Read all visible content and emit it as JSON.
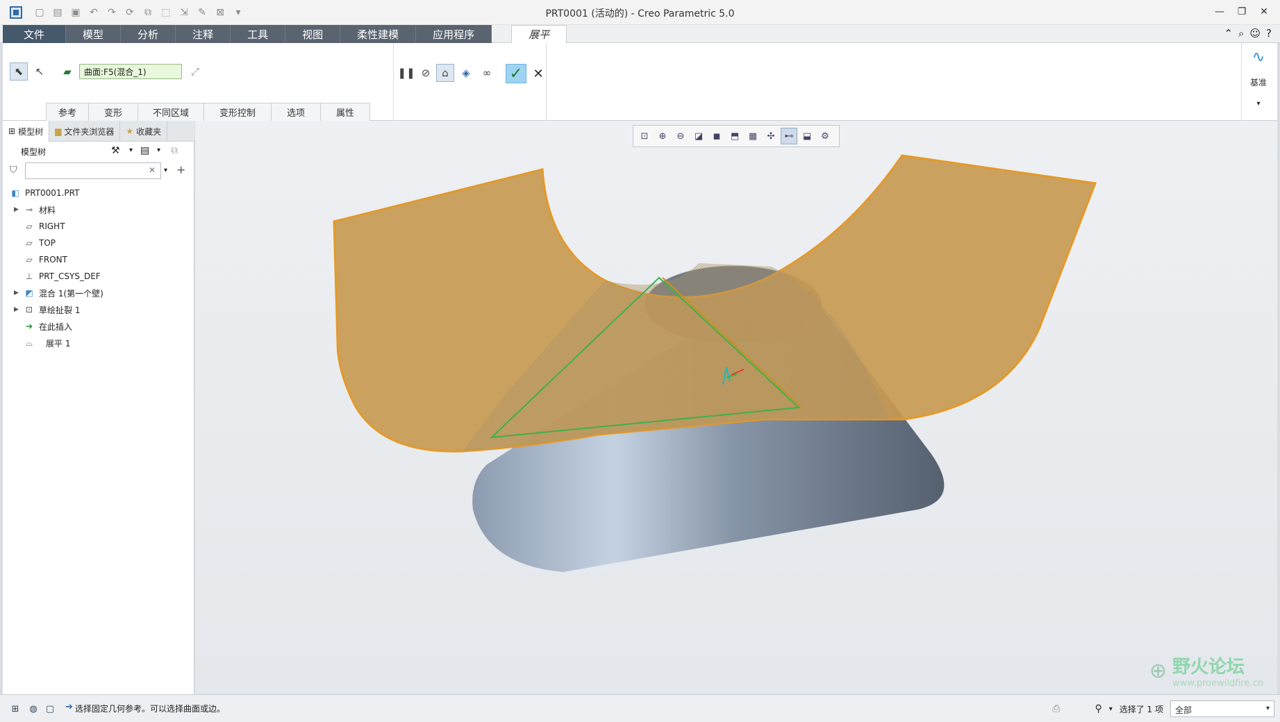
{
  "window": {
    "title": "PRT0001 (活动的) - Creo Parametric 5.0",
    "minimize_icon": "—",
    "restore_icon": "❐",
    "close_icon": "✕"
  },
  "menu": {
    "tabs": [
      {
        "label": "文件"
      },
      {
        "label": "模型"
      },
      {
        "label": "分析"
      },
      {
        "label": "注释"
      },
      {
        "label": "工具"
      },
      {
        "label": "视图"
      },
      {
        "label": "柔性建模"
      },
      {
        "label": "应用程序"
      },
      {
        "label": "展平"
      }
    ],
    "active_tab": "展平"
  },
  "ribbon": {
    "reference_value": "曲面:F5(混合_1)",
    "sub_tabs": [
      "参考",
      "变形",
      "不同区域",
      "变形控制",
      "选项",
      "属性"
    ],
    "datum_label": "基准"
  },
  "left_panel": {
    "nav_tabs": [
      "模型树",
      "文件夹浏览器",
      "收藏夹"
    ],
    "tree_title": "模型树",
    "filter_value": "",
    "tree_items": [
      {
        "label": "PRT0001.PRT",
        "icon": "part-icon"
      },
      {
        "label": "材料",
        "icon": "material-icon"
      },
      {
        "label": "RIGHT",
        "icon": "datum-plane-icon"
      },
      {
        "label": "TOP",
        "icon": "datum-plane-icon"
      },
      {
        "label": "FRONT",
        "icon": "datum-plane-icon"
      },
      {
        "label": "PRT_CSYS_DEF",
        "icon": "csys-icon"
      },
      {
        "label": "混合 1(第一个壁)",
        "icon": "blend-icon"
      },
      {
        "label": "草绘扯裂 1",
        "icon": "sketch-rip-icon"
      },
      {
        "label": "在此插入",
        "icon": "insert-here-icon"
      },
      {
        "label": "展平 1",
        "icon": "flatten-icon"
      }
    ]
  },
  "statusbar": {
    "message": "选择固定几何参考。可以选择曲面或边。",
    "selection_count": "选择了 1 项",
    "filter_value": "全部"
  },
  "watermark": {
    "title": "野火论坛",
    "url": "www.proewildfire.cn"
  },
  "colors": {
    "accent": "#46586b",
    "flat_surface": "#c89a52",
    "cone": "#9aa7b8",
    "ok_button": "#9fd3f2"
  }
}
